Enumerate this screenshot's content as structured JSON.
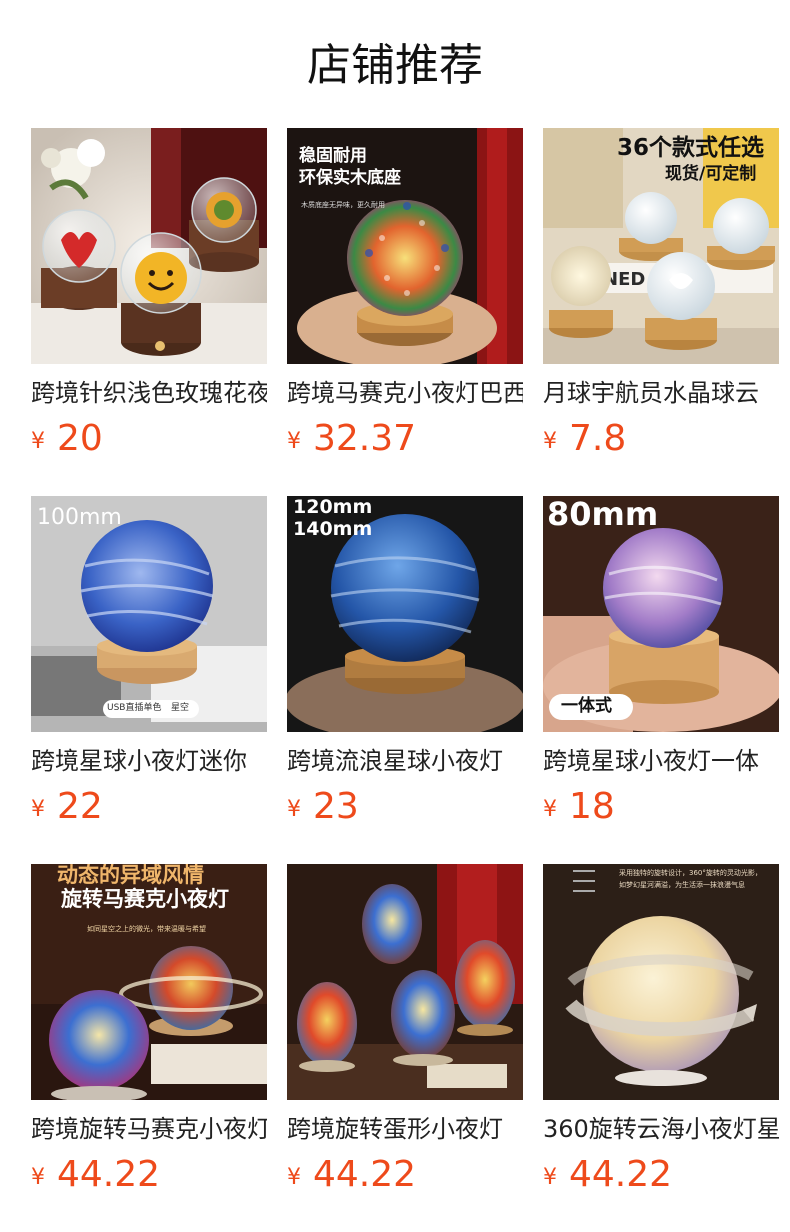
{
  "section_title": "店铺推荐",
  "currency_symbol": "¥",
  "products": [
    {
      "name": "跨境针织浅色玫瑰花夜灯",
      "price": "20",
      "image_text": []
    },
    {
      "name": "跨境马赛克小夜灯巴西",
      "price": "32.37",
      "image_text": [
        "稳固耐用",
        "环保实木底座",
        "木质底座无异味，更久耐用"
      ]
    },
    {
      "name": "月球宇航员水晶球云",
      "price": "7.8",
      "image_text": [
        "36个款式任选",
        "现货/可定制"
      ]
    },
    {
      "name": "跨境星球小夜灯迷你",
      "price": "22",
      "image_text": [
        "100mm",
        "USB直插单色",
        "星空"
      ]
    },
    {
      "name": "跨境流浪星球小夜灯",
      "price": "23",
      "image_text": [
        "120mm",
        "140mm"
      ]
    },
    {
      "name": "跨境星球小夜灯一体",
      "price": "18",
      "image_text": [
        "80mm",
        "一体式"
      ]
    },
    {
      "name": "跨境旋转马赛克小夜灯",
      "price": "44.22",
      "image_text": [
        "动态的异域风情",
        "旋转马赛克小夜灯",
        "如同星空之上的微光，带来温暖与希望"
      ]
    },
    {
      "name": "跨境旋转蛋形小夜灯",
      "price": "44.22",
      "image_text": []
    },
    {
      "name": "360旋转云海小夜灯星",
      "price": "44.22",
      "image_text": [
        "采用独特的旋转设计，360°旋转的灵动光影，",
        "如梦幻星河满溢，为生活添一抹浪漫气息"
      ]
    }
  ],
  "colors": {
    "price": "#ee4a1b",
    "title": "#111111",
    "name": "#222222"
  }
}
